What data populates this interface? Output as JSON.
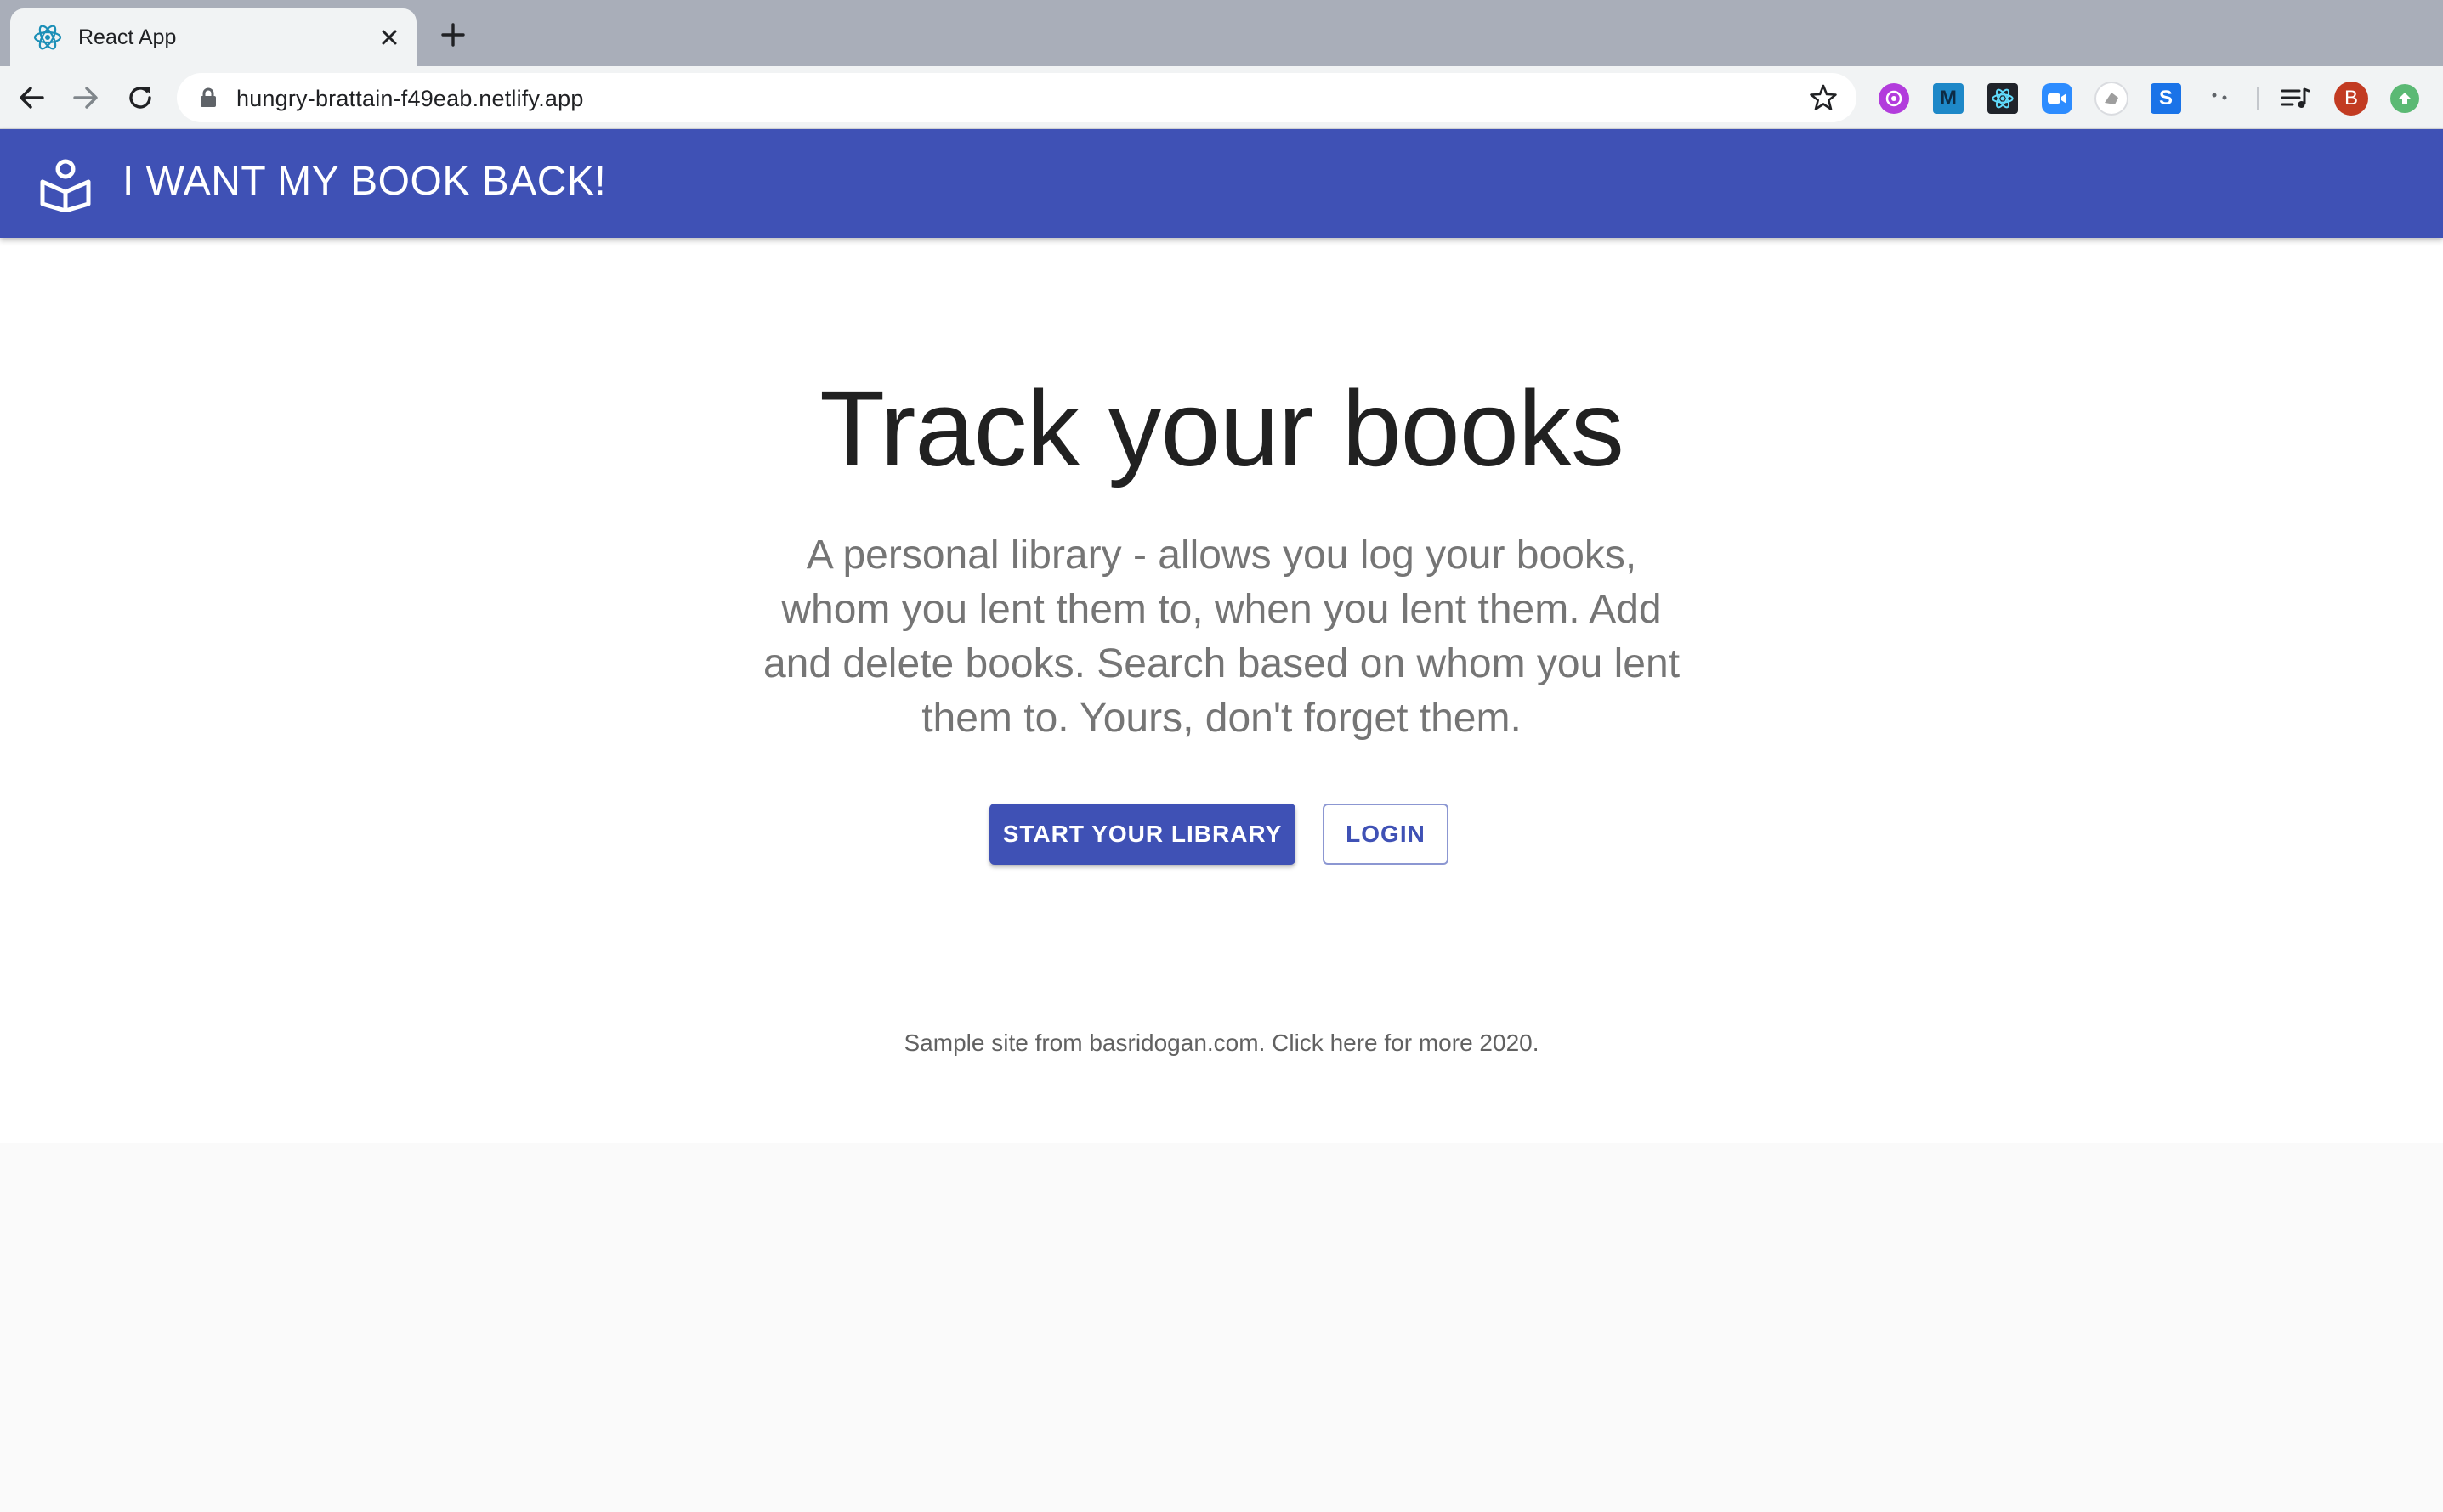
{
  "browser": {
    "tab_title": "React App",
    "url": "hungry-brattain-f49eab.netlify.app",
    "extensions": [
      {
        "name": "purple-extension-icon",
        "color": "#b23cdc"
      },
      {
        "name": "m-extension-icon",
        "label": "M",
        "color": "#1e88c8"
      },
      {
        "name": "react-devtools-icon",
        "color": "#20232a"
      },
      {
        "name": "zoom-extension-icon",
        "color": "#2d8cff"
      },
      {
        "name": "grey-extension-icon",
        "color": "#9e9e9e"
      },
      {
        "name": "s-extension-icon",
        "label": "S",
        "color": "#1a73e8"
      },
      {
        "name": "dots-extension-icon",
        "color": "#5f6368"
      }
    ],
    "profile_initial": "B",
    "profile_color": "#c23b22",
    "update_color": "#5bb974"
  },
  "app": {
    "title": "I WANT MY BOOK BACK!",
    "brand_color": "#3f51b5"
  },
  "hero": {
    "title": "Track your books",
    "description": "A personal library - allows you log your books, whom you lent them to, when you lent them. Add and delete books. Search based on whom you lent them to. Yours, don't forget them.",
    "primary_button": "START YOUR LIBRARY",
    "secondary_button": "LOGIN"
  },
  "footer": {
    "text": "Sample site from basridogan.com. Click here for more 2020."
  }
}
